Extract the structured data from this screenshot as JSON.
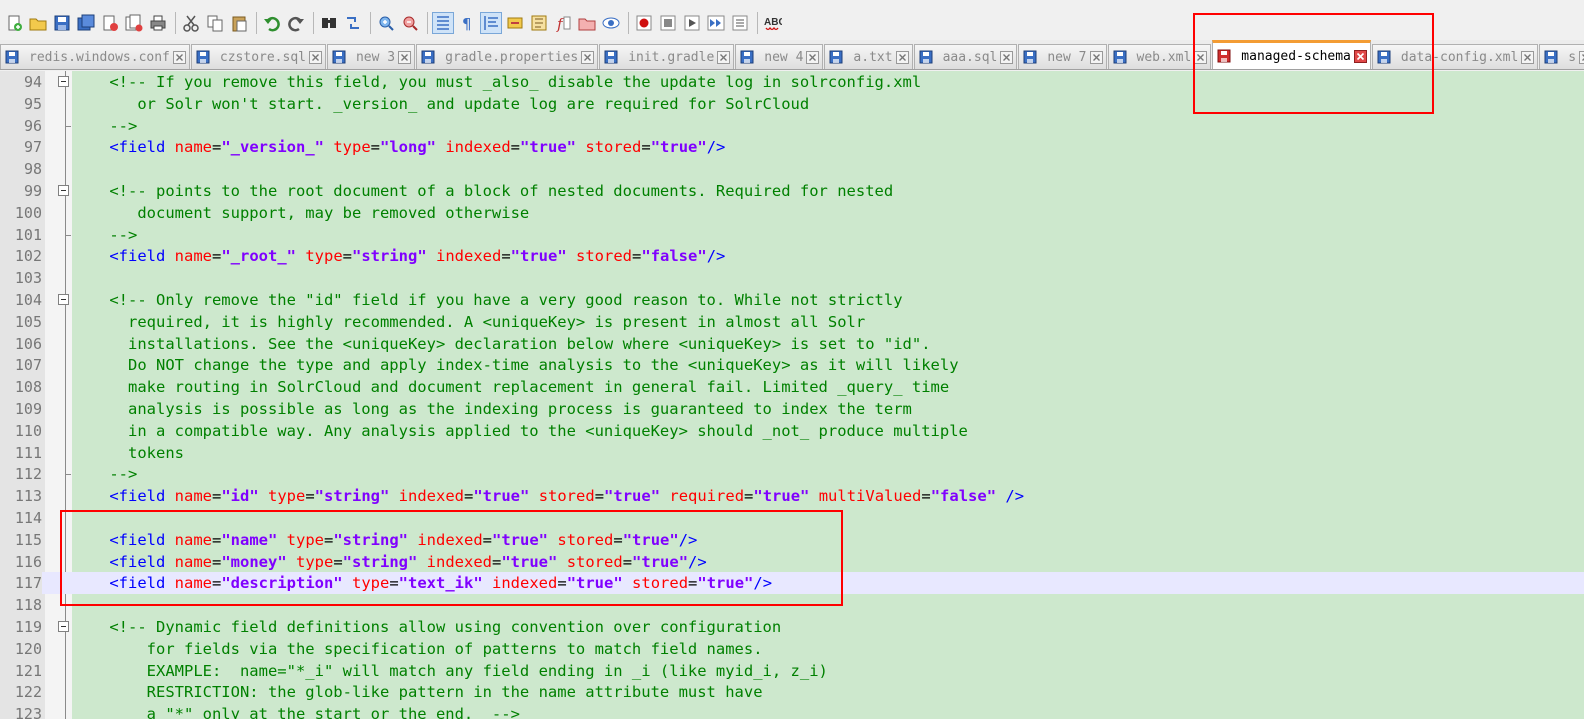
{
  "toolbar": {
    "buttons": [
      {
        "name": "new-file-icon",
        "kind": "new"
      },
      {
        "name": "open-file-icon",
        "kind": "open"
      },
      {
        "name": "save-icon",
        "kind": "save"
      },
      {
        "name": "save-all-icon",
        "kind": "saveall"
      },
      {
        "name": "close-file-icon",
        "kind": "close"
      },
      {
        "name": "close-all-icon",
        "kind": "closeall"
      },
      {
        "name": "print-icon",
        "kind": "print"
      },
      {
        "sep": true
      },
      {
        "name": "cut-icon",
        "kind": "cut"
      },
      {
        "name": "copy-icon",
        "kind": "copy"
      },
      {
        "name": "paste-icon",
        "kind": "paste"
      },
      {
        "sep": true
      },
      {
        "name": "undo-icon",
        "kind": "undo"
      },
      {
        "name": "redo-icon",
        "kind": "redo"
      },
      {
        "sep": true
      },
      {
        "name": "find-icon",
        "kind": "find"
      },
      {
        "name": "replace-icon",
        "kind": "replace"
      },
      {
        "sep": true
      },
      {
        "name": "zoom-in-icon",
        "kind": "zoomin"
      },
      {
        "name": "zoom-out-icon",
        "kind": "zoomout"
      },
      {
        "sep": true
      },
      {
        "name": "sync-vertical-icon",
        "kind": "syncv",
        "active": true
      },
      {
        "name": "show-all-chars-icon",
        "kind": "pilcrow"
      },
      {
        "name": "indent-guide-icon",
        "kind": "indent",
        "active": true
      },
      {
        "name": "user-language-icon",
        "kind": "udl"
      },
      {
        "name": "doc-map-icon",
        "kind": "docmap"
      },
      {
        "name": "function-list-icon",
        "kind": "funclist"
      },
      {
        "name": "folder-workspace-icon",
        "kind": "folder"
      },
      {
        "name": "monitoring-icon",
        "kind": "eye"
      },
      {
        "sep": true
      },
      {
        "name": "record-macro-icon",
        "kind": "record"
      },
      {
        "name": "stop-macro-icon",
        "kind": "stop"
      },
      {
        "name": "play-macro-icon",
        "kind": "play"
      },
      {
        "name": "play-multiple-icon",
        "kind": "playmulti"
      },
      {
        "name": "save-macro-icon",
        "kind": "savemacro"
      },
      {
        "sep": true
      },
      {
        "name": "spell-check-icon",
        "kind": "abc"
      }
    ],
    "spell_label": "ABC"
  },
  "tabs": [
    {
      "label": "redis.windows.conf",
      "saved": true
    },
    {
      "label": "czstore.sql",
      "saved": true
    },
    {
      "label": "new 3",
      "saved": true
    },
    {
      "label": "gradle.properties",
      "saved": true
    },
    {
      "label": "init.gradle",
      "saved": true
    },
    {
      "label": "new 4",
      "saved": true
    },
    {
      "label": "a.txt",
      "saved": true
    },
    {
      "label": "aaa.sql",
      "saved": true
    },
    {
      "label": "new 7",
      "saved": true
    },
    {
      "label": "web.xml",
      "saved": true
    },
    {
      "label": "managed-schema",
      "saved": false,
      "active": true
    },
    {
      "label": "data-config.xml",
      "saved": true
    },
    {
      "label": "s",
      "saved": true
    }
  ],
  "editor": {
    "current_line": 117,
    "lines": [
      {
        "n": "94",
        "fold": "start",
        "tokens": [
          [
            "c",
            "    <!-- If you remove this field, you must _also_ disable the update log in solrconfig.xml"
          ]
        ]
      },
      {
        "n": "95",
        "tokens": [
          [
            "c",
            "       or Solr won't start. _version_ and update log are required for SolrCloud"
          ]
        ]
      },
      {
        "n": "96",
        "fold": "end",
        "tokens": [
          [
            "c",
            "    -->"
          ]
        ]
      },
      {
        "n": "97",
        "tokens": [
          [
            "t",
            "    <field "
          ],
          [
            "a",
            "name"
          ],
          [
            "e",
            "="
          ],
          [
            "v",
            "\"_version_\""
          ],
          [
            "t",
            " "
          ],
          [
            "a",
            "type"
          ],
          [
            "e",
            "="
          ],
          [
            "v",
            "\"long\""
          ],
          [
            "t",
            " "
          ],
          [
            "a",
            "indexed"
          ],
          [
            "e",
            "="
          ],
          [
            "v",
            "\"true\""
          ],
          [
            "t",
            " "
          ],
          [
            "a",
            "stored"
          ],
          [
            "e",
            "="
          ],
          [
            "v",
            "\"true\""
          ],
          [
            "t",
            "/>"
          ]
        ]
      },
      {
        "n": "98",
        "tokens": []
      },
      {
        "n": "99",
        "fold": "start",
        "tokens": [
          [
            "c",
            "    <!-- points to the root document of a block of nested documents. Required for nested"
          ]
        ]
      },
      {
        "n": "100",
        "tokens": [
          [
            "c",
            "       document support, may be removed otherwise"
          ]
        ]
      },
      {
        "n": "101",
        "fold": "end",
        "tokens": [
          [
            "c",
            "    -->"
          ]
        ]
      },
      {
        "n": "102",
        "tokens": [
          [
            "t",
            "    <field "
          ],
          [
            "a",
            "name"
          ],
          [
            "e",
            "="
          ],
          [
            "v",
            "\"_root_\""
          ],
          [
            "t",
            " "
          ],
          [
            "a",
            "type"
          ],
          [
            "e",
            "="
          ],
          [
            "v",
            "\"string\""
          ],
          [
            "t",
            " "
          ],
          [
            "a",
            "indexed"
          ],
          [
            "e",
            "="
          ],
          [
            "v",
            "\"true\""
          ],
          [
            "t",
            " "
          ],
          [
            "a",
            "stored"
          ],
          [
            "e",
            "="
          ],
          [
            "v",
            "\"false\""
          ],
          [
            "t",
            "/>"
          ]
        ]
      },
      {
        "n": "103",
        "tokens": []
      },
      {
        "n": "104",
        "fold": "start",
        "tokens": [
          [
            "c",
            "    <!-- Only remove the \"id\" field if you have a very good reason to. While not strictly"
          ]
        ]
      },
      {
        "n": "105",
        "tokens": [
          [
            "c",
            "      required, it is highly recommended. A <uniqueKey> is present in almost all Solr"
          ]
        ]
      },
      {
        "n": "106",
        "tokens": [
          [
            "c",
            "      installations. See the <uniqueKey> declaration below where <uniqueKey> is set to \"id\"."
          ]
        ]
      },
      {
        "n": "107",
        "tokens": [
          [
            "c",
            "      Do NOT change the type and apply index-time analysis to the <uniqueKey> as it will likely"
          ]
        ]
      },
      {
        "n": "108",
        "tokens": [
          [
            "c",
            "      make routing in SolrCloud and document replacement in general fail. Limited _query_ time"
          ]
        ]
      },
      {
        "n": "109",
        "tokens": [
          [
            "c",
            "      analysis is possible as long as the indexing process is guaranteed to index the term"
          ]
        ]
      },
      {
        "n": "110",
        "tokens": [
          [
            "c",
            "      in a compatible way. Any analysis applied to the <uniqueKey> should _not_ produce multiple"
          ]
        ]
      },
      {
        "n": "111",
        "tokens": [
          [
            "c",
            "      tokens"
          ]
        ]
      },
      {
        "n": "112",
        "fold": "end",
        "tokens": [
          [
            "c",
            "    -->"
          ]
        ]
      },
      {
        "n": "113",
        "tokens": [
          [
            "t",
            "    <field "
          ],
          [
            "a",
            "name"
          ],
          [
            "e",
            "="
          ],
          [
            "v",
            "\"id\""
          ],
          [
            "t",
            " "
          ],
          [
            "a",
            "type"
          ],
          [
            "e",
            "="
          ],
          [
            "v",
            "\"string\""
          ],
          [
            "t",
            " "
          ],
          [
            "a",
            "indexed"
          ],
          [
            "e",
            "="
          ],
          [
            "v",
            "\"true\""
          ],
          [
            "t",
            " "
          ],
          [
            "a",
            "stored"
          ],
          [
            "e",
            "="
          ],
          [
            "v",
            "\"true\""
          ],
          [
            "t",
            " "
          ],
          [
            "a",
            "required"
          ],
          [
            "e",
            "="
          ],
          [
            "v",
            "\"true\""
          ],
          [
            "t",
            " "
          ],
          [
            "a",
            "multiValued"
          ],
          [
            "e",
            "="
          ],
          [
            "v",
            "\"false\""
          ],
          [
            "t",
            " />"
          ]
        ]
      },
      {
        "n": "114",
        "tokens": []
      },
      {
        "n": "115",
        "tokens": [
          [
            "t",
            "    <field "
          ],
          [
            "a",
            "name"
          ],
          [
            "e",
            "="
          ],
          [
            "v",
            "\"name\""
          ],
          [
            "t",
            " "
          ],
          [
            "a",
            "type"
          ],
          [
            "e",
            "="
          ],
          [
            "v",
            "\"string\""
          ],
          [
            "t",
            " "
          ],
          [
            "a",
            "indexed"
          ],
          [
            "e",
            "="
          ],
          [
            "v",
            "\"true\""
          ],
          [
            "t",
            " "
          ],
          [
            "a",
            "stored"
          ],
          [
            "e",
            "="
          ],
          [
            "v",
            "\"true\""
          ],
          [
            "t",
            "/>"
          ]
        ]
      },
      {
        "n": "116",
        "tokens": [
          [
            "t",
            "    <field "
          ],
          [
            "a",
            "name"
          ],
          [
            "e",
            "="
          ],
          [
            "v",
            "\"money\""
          ],
          [
            "t",
            " "
          ],
          [
            "a",
            "type"
          ],
          [
            "e",
            "="
          ],
          [
            "v",
            "\"string\""
          ],
          [
            "t",
            " "
          ],
          [
            "a",
            "indexed"
          ],
          [
            "e",
            "="
          ],
          [
            "v",
            "\"true\""
          ],
          [
            "t",
            " "
          ],
          [
            "a",
            "stored"
          ],
          [
            "e",
            "="
          ],
          [
            "v",
            "\"true\""
          ],
          [
            "t",
            "/>"
          ]
        ]
      },
      {
        "n": "117",
        "tokens": [
          [
            "t",
            "    <field "
          ],
          [
            "a",
            "name"
          ],
          [
            "e",
            "="
          ],
          [
            "v",
            "\"description\""
          ],
          [
            "t",
            " "
          ],
          [
            "a",
            "type"
          ],
          [
            "e",
            "="
          ],
          [
            "v",
            "\"text_ik\""
          ],
          [
            "t",
            " "
          ],
          [
            "a",
            "indexed"
          ],
          [
            "e",
            "="
          ],
          [
            "v",
            "\"true\""
          ],
          [
            "t",
            " "
          ],
          [
            "a",
            "stored"
          ],
          [
            "e",
            "="
          ],
          [
            "v",
            "\"true\""
          ],
          [
            "t",
            "/>"
          ]
        ]
      },
      {
        "n": "118",
        "tokens": []
      },
      {
        "n": "119",
        "fold": "start",
        "tokens": [
          [
            "c",
            "    <!-- Dynamic field definitions allow using convention over configuration"
          ]
        ]
      },
      {
        "n": "120",
        "tokens": [
          [
            "c",
            "        for fields via the specification of patterns to match field names."
          ]
        ]
      },
      {
        "n": "121",
        "tokens": [
          [
            "c",
            "        EXAMPLE:  name=\"*_i\" will match any field ending in _i (like myid_i, z_i)"
          ]
        ]
      },
      {
        "n": "122",
        "tokens": [
          [
            "c",
            "        RESTRICTION: the glob-like pattern in the name attribute must have"
          ]
        ]
      },
      {
        "n": "123",
        "tokens": [
          [
            "c",
            "        a \"*\" only at the start or the end.  -->"
          ]
        ]
      }
    ]
  },
  "colors": {
    "editor_bg": "#cde8cd",
    "comment": "#008000",
    "tag": "#0000ff",
    "attr": "#ff0000",
    "value": "#8000ff",
    "current_line": "#e8e8ff",
    "annotation": "#ff0000",
    "active_tab_accent": "#f39c34"
  }
}
